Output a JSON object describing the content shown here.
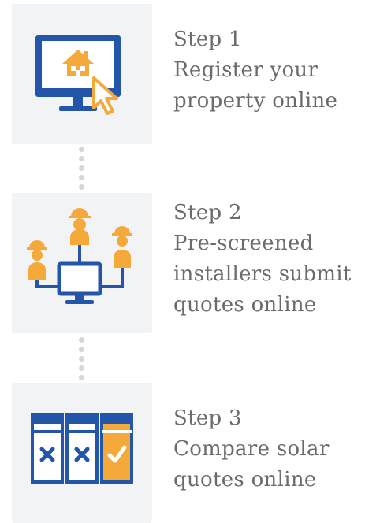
{
  "steps": [
    {
      "title": "Step 1",
      "lines": [
        "Register your",
        "property online"
      ],
      "icon": "computer-house-cursor-icon"
    },
    {
      "title": "Step 2",
      "lines": [
        "Pre-screened",
        "installers submit",
        "quotes online"
      ],
      "icon": "installers-computer-icon"
    },
    {
      "title": "Step 3",
      "lines": [
        "Compare solar",
        "quotes online"
      ],
      "icon": "compare-quotes-icon"
    }
  ],
  "colors": {
    "blue": "#2356a8",
    "orange": "#f5a93a",
    "tile": "#f2f3f5",
    "text": "#6b6b6b",
    "dot": "#d4d6da"
  }
}
